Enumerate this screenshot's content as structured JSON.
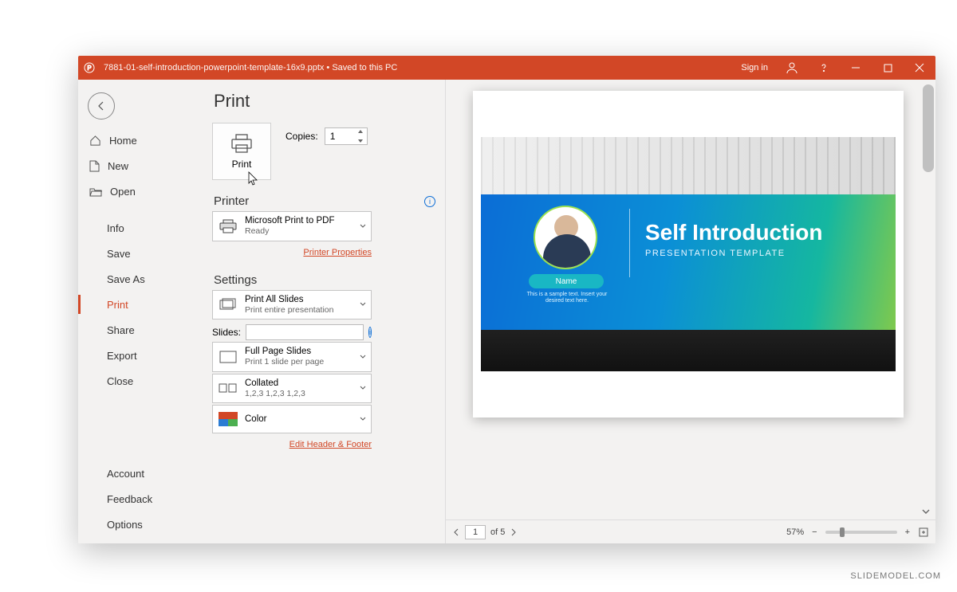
{
  "titlebar": {
    "filename": "7881-01-self-introduction-powerpoint-template-16x9.pptx",
    "save_status": "Saved to this PC",
    "signin": "Sign in"
  },
  "sidebar": {
    "back": "Back",
    "home": "Home",
    "new": "New",
    "open": "Open",
    "info": "Info",
    "save": "Save",
    "saveas": "Save As",
    "print": "Print",
    "share": "Share",
    "export": "Export",
    "close": "Close",
    "account": "Account",
    "feedback": "Feedback",
    "options": "Options"
  },
  "print": {
    "title": "Print",
    "button": "Print",
    "copies_label": "Copies:",
    "copies_value": "1",
    "printer_heading": "Printer",
    "printer_name": "Microsoft Print to PDF",
    "printer_status": "Ready",
    "printer_properties": "Printer Properties",
    "settings_heading": "Settings",
    "scope_main": "Print All Slides",
    "scope_sub": "Print entire presentation",
    "slides_label": "Slides:",
    "slides_value": "",
    "layout_main": "Full Page Slides",
    "layout_sub": "Print 1 slide per page",
    "collate_main": "Collated",
    "collate_sub": "1,2,3    1,2,3    1,2,3",
    "color": "Color",
    "edit_header_footer": "Edit Header & Footer"
  },
  "preview": {
    "slide_title": "Self Introduction",
    "slide_subtitle": "PRESENTATION TEMPLATE",
    "name_pill": "Name",
    "sample_text": "This is a sample text. Insert your desired text here.",
    "page_current": "1",
    "page_total_label": "of 5",
    "zoom": "57%"
  },
  "watermark": "SLIDEMODEL.COM"
}
